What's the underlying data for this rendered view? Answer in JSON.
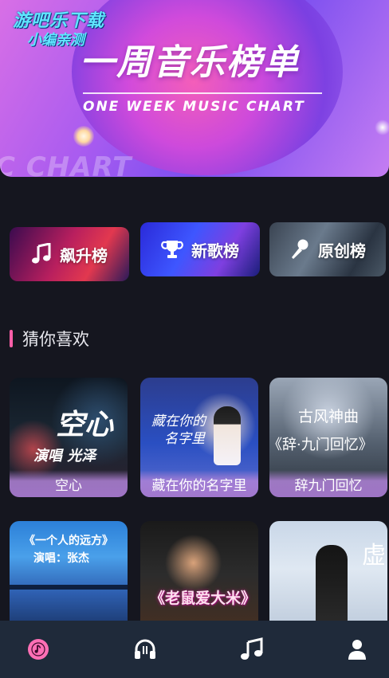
{
  "watermark": {
    "line1": "游吧乐下载",
    "line2": "小编亲测"
  },
  "banner": {
    "title": "一周音乐榜单",
    "subtitle": "ONE WEEK MUSIC CHART",
    "ghost_text": "C CHART"
  },
  "charts": [
    {
      "label": "飙升榜",
      "icon": "music-note-icon"
    },
    {
      "label": "新歌榜",
      "icon": "trophy-icon"
    },
    {
      "label": "原创榜",
      "icon": "microphone-icon"
    }
  ],
  "section": {
    "title": "猜你喜欢",
    "accent": "#ff5fa8"
  },
  "songs": [
    {
      "title": "空心",
      "art_line1": "空心",
      "art_line2": "演唱  光泽"
    },
    {
      "title": "藏在你的名字里",
      "art_line1": "藏在你的",
      "art_line2": "名字里"
    },
    {
      "title": "辞九门回忆",
      "art_line1": "古风神曲",
      "art_line2": "《辞·九门回忆》"
    },
    {
      "title": "",
      "art_line1": "《一个人的远方》",
      "art_line2": "演唱：张杰"
    },
    {
      "title": "",
      "art_line1": "《老鼠爱大米》",
      "art_line2": ""
    },
    {
      "title": "",
      "art_line1": "虚",
      "art_line2": ""
    }
  ],
  "nav": [
    {
      "name": "home",
      "icon": "music-disc-icon",
      "active": true
    },
    {
      "name": "listen",
      "icon": "headphones-icon",
      "active": false
    },
    {
      "name": "music",
      "icon": "music-notes-icon",
      "active": false
    },
    {
      "name": "profile",
      "icon": "user-icon",
      "active": false
    }
  ],
  "colors": {
    "background": "#15161f",
    "nav_bg": "#1f2a3a",
    "accent_pink": "#ff6fb5"
  }
}
